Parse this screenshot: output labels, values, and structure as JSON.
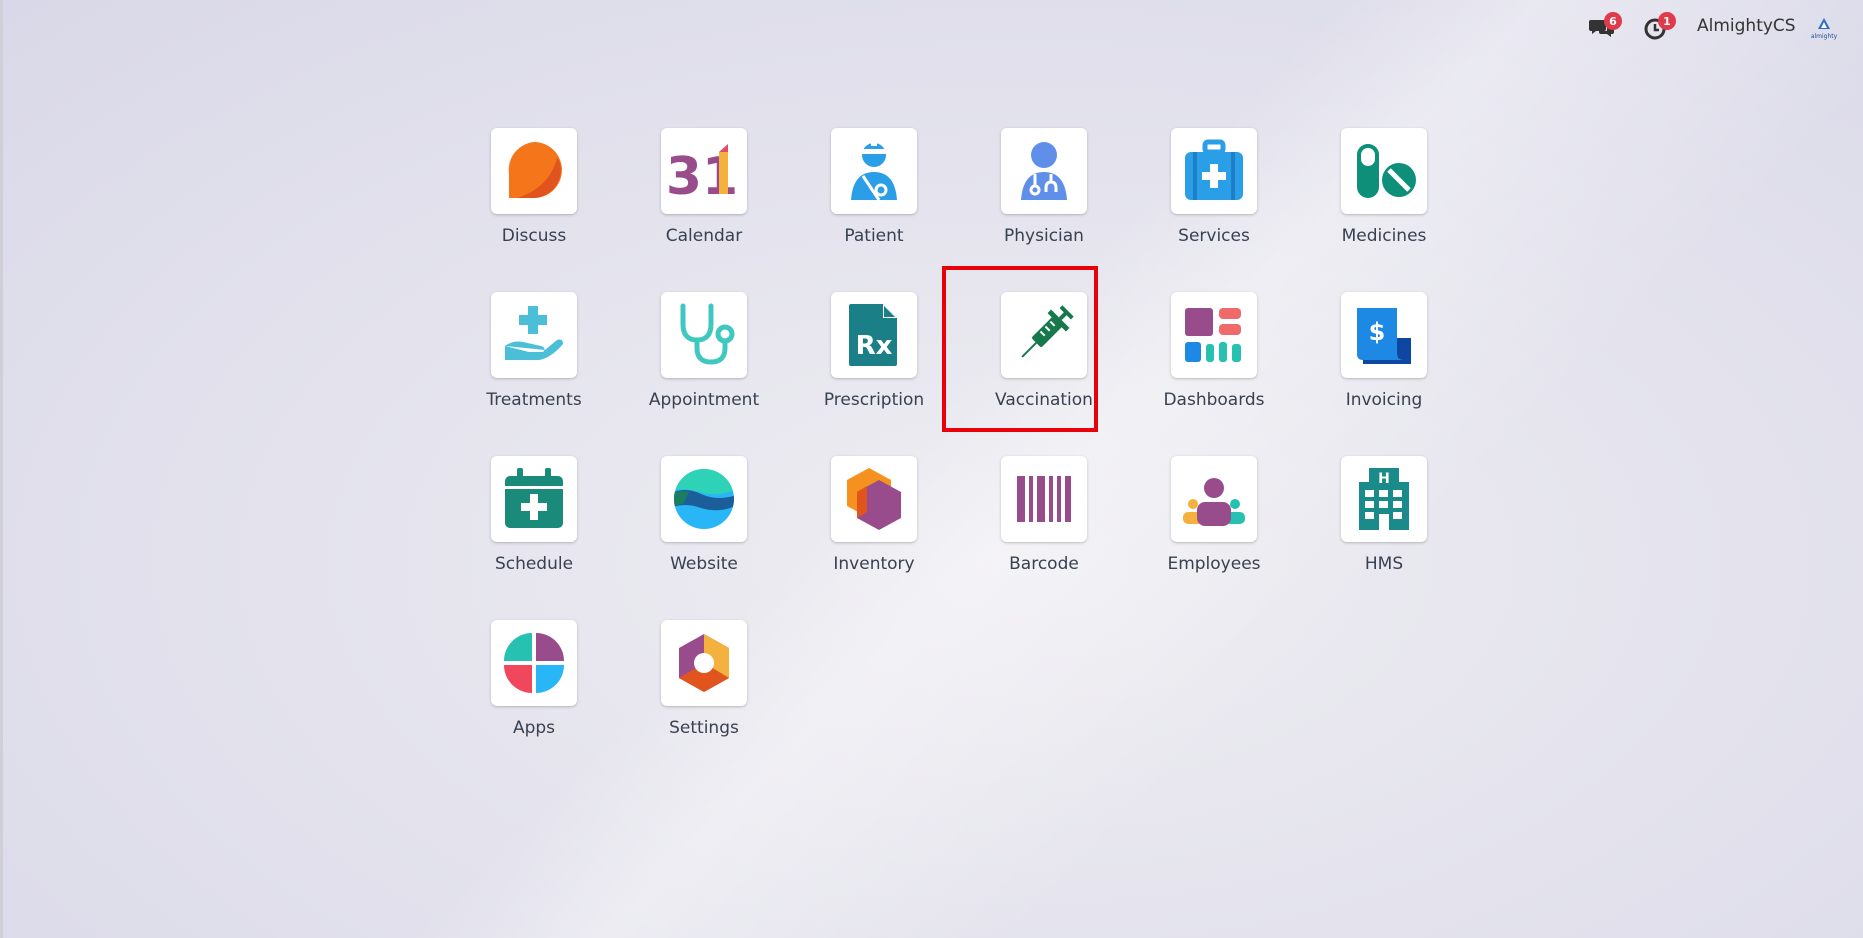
{
  "topbar": {
    "messages_count": "6",
    "activities_count": "1",
    "username": "AlmightyCS",
    "avatar_text": "almighty"
  },
  "apps": [
    {
      "label": "Discuss",
      "icon": "discuss-icon"
    },
    {
      "label": "Calendar",
      "icon": "calendar-icon",
      "icon_text": "31"
    },
    {
      "label": "Patient",
      "icon": "patient-icon"
    },
    {
      "label": "Physician",
      "icon": "physician-icon"
    },
    {
      "label": "Services",
      "icon": "services-icon"
    },
    {
      "label": "Medicines",
      "icon": "medicines-icon"
    },
    {
      "label": "Treatments",
      "icon": "treatments-icon"
    },
    {
      "label": "Appointment",
      "icon": "appointment-icon"
    },
    {
      "label": "Prescription",
      "icon": "prescription-icon",
      "icon_text": "Rx"
    },
    {
      "label": "Vaccination",
      "icon": "vaccination-icon"
    },
    {
      "label": "Dashboards",
      "icon": "dashboards-icon"
    },
    {
      "label": "Invoicing",
      "icon": "invoicing-icon",
      "icon_text": "$"
    },
    {
      "label": "Schedule",
      "icon": "schedule-icon"
    },
    {
      "label": "Website",
      "icon": "website-icon"
    },
    {
      "label": "Inventory",
      "icon": "inventory-icon"
    },
    {
      "label": "Barcode",
      "icon": "barcode-icon"
    },
    {
      "label": "Employees",
      "icon": "employees-icon"
    },
    {
      "label": "HMS",
      "icon": "hms-icon",
      "icon_text": "H"
    },
    {
      "label": "Apps",
      "icon": "apps-icon"
    },
    {
      "label": "Settings",
      "icon": "settings-icon"
    }
  ],
  "highlighted_app": "Vaccination",
  "colors": {
    "highlight_border": "#e8000b",
    "badge": "#e03b4a",
    "teal": "#1a8a8a",
    "purple": "#984c8c"
  }
}
